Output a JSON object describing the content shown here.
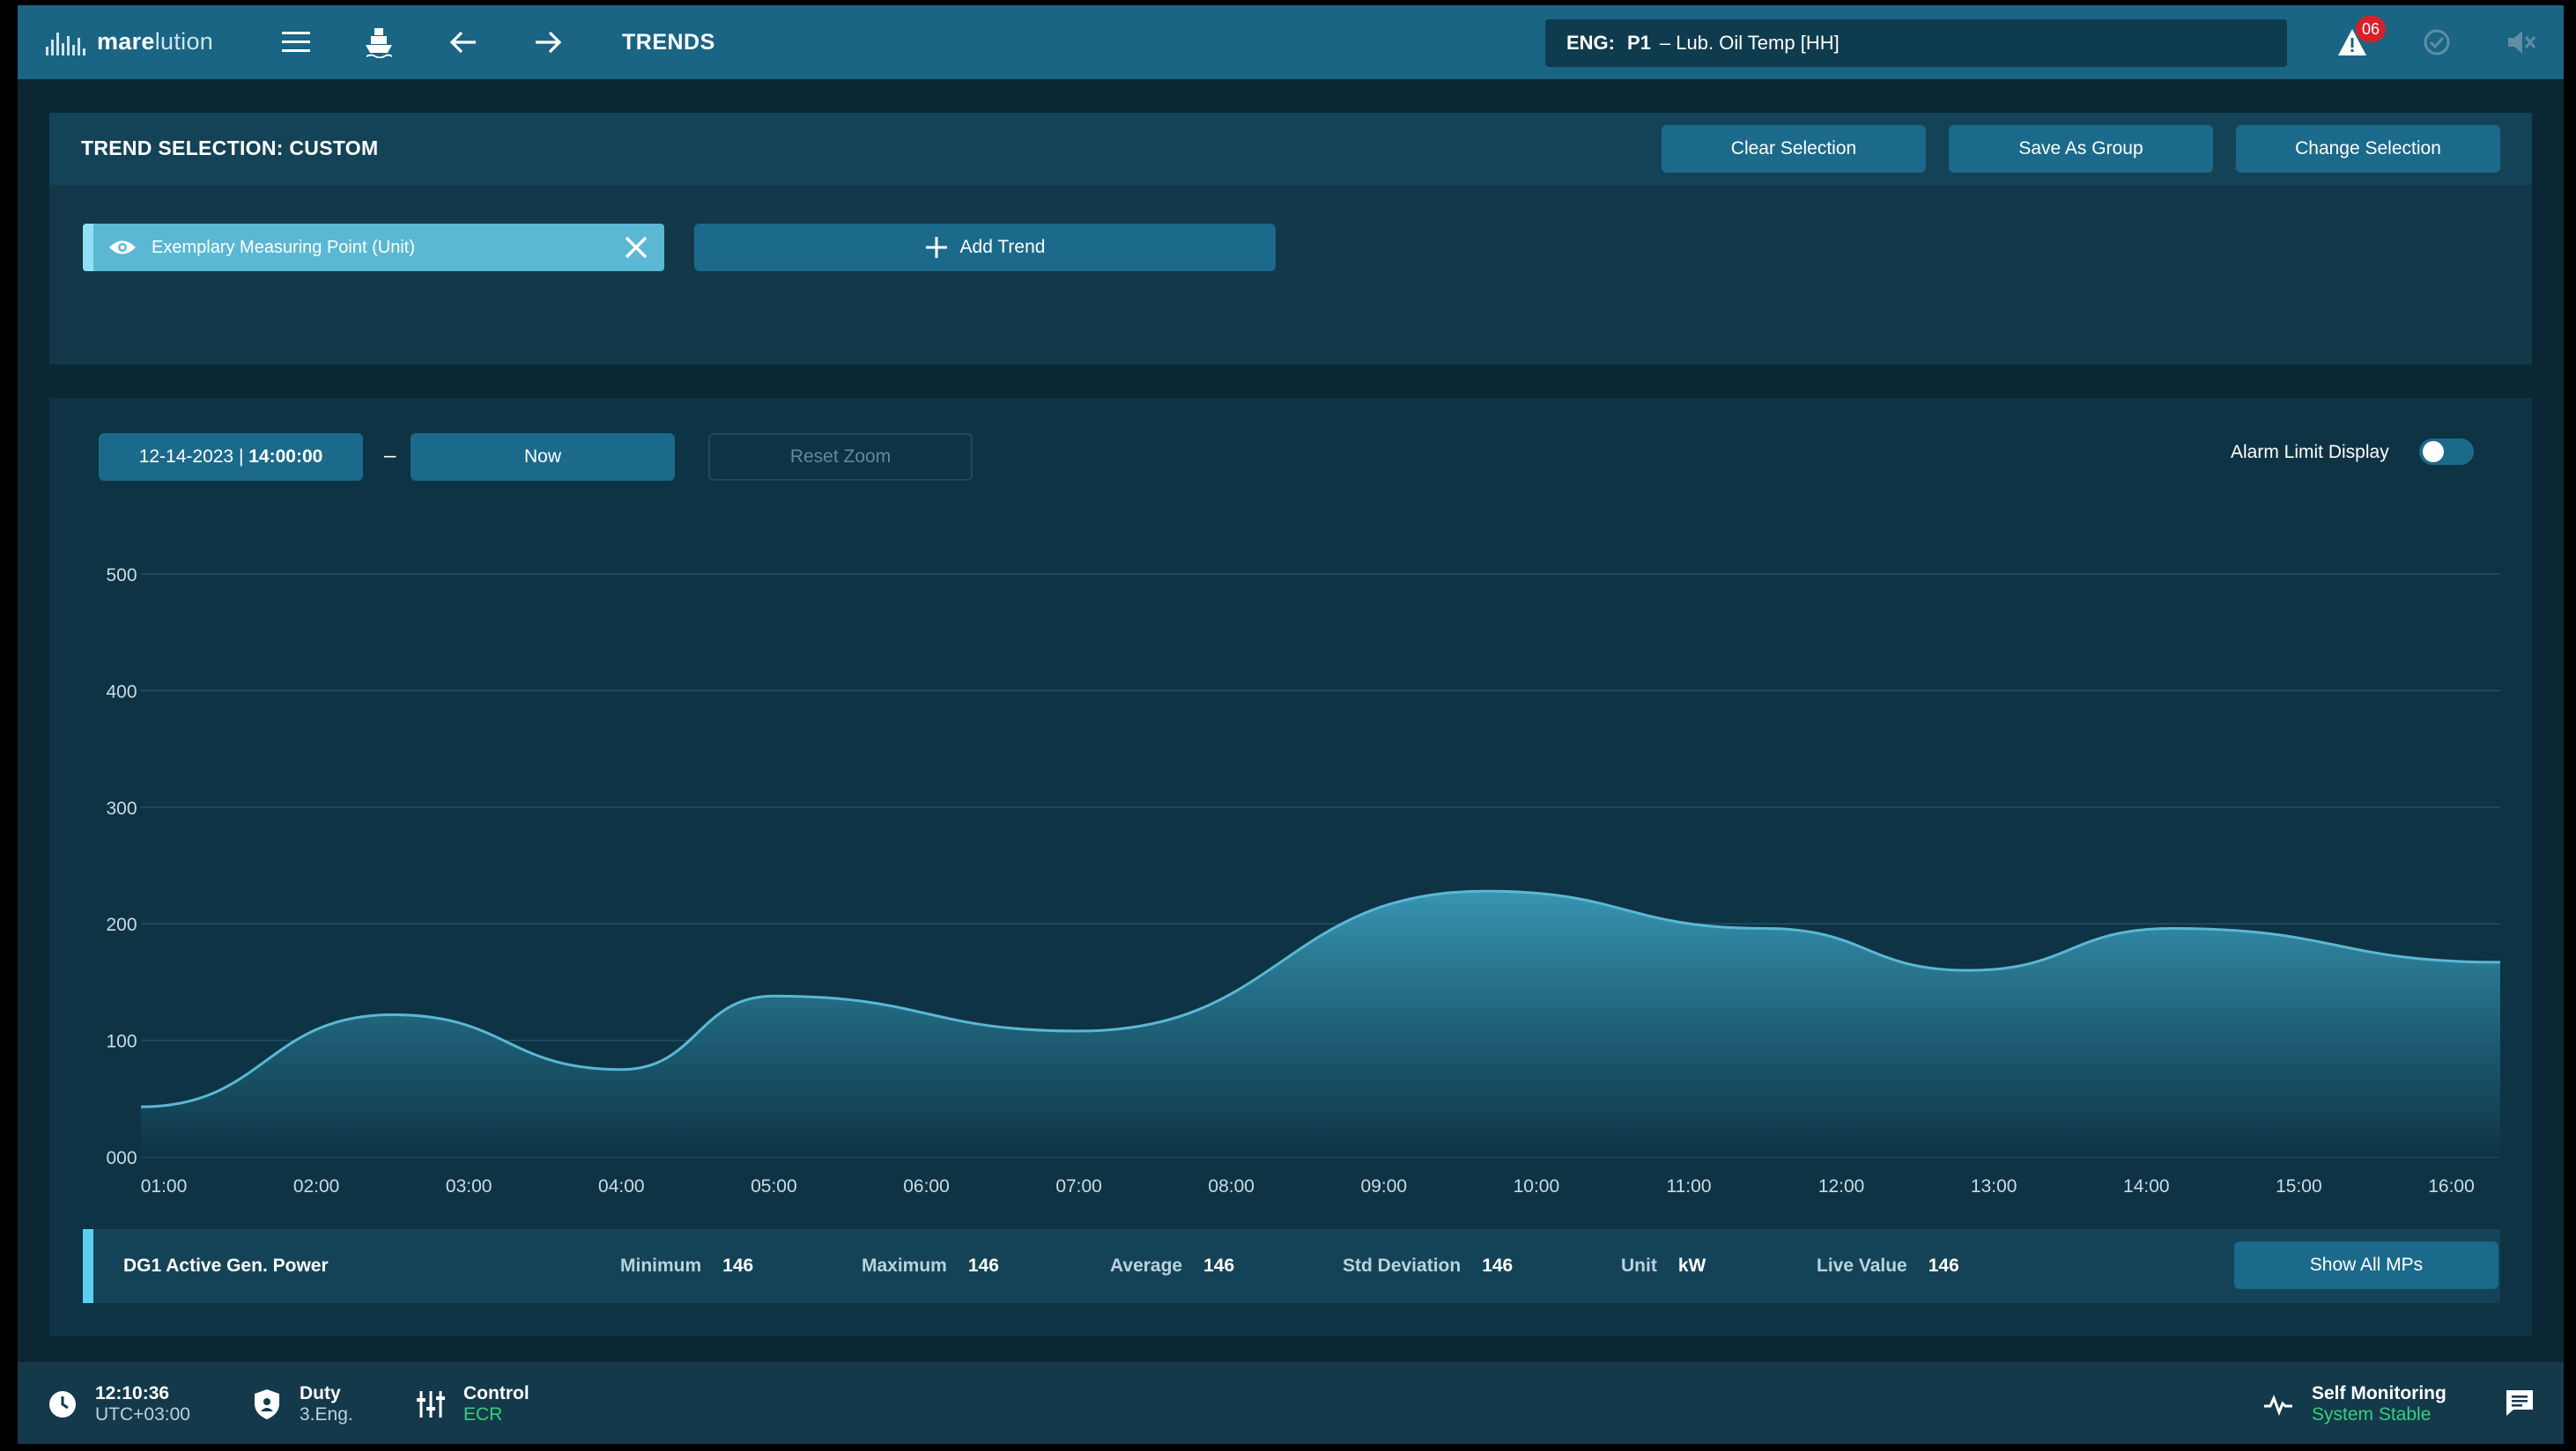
{
  "app": {
    "brand_bold": "mare",
    "brand_rest": "lution",
    "page_title": "TRENDS"
  },
  "alarm": {
    "key": "ENG:",
    "point": "P1",
    "text": "– Lub. Oil Temp [HH]",
    "count": "06"
  },
  "selection": {
    "title": "TREND SELECTION: CUSTOM",
    "clear_label": "Clear Selection",
    "save_label": "Save As Group",
    "change_label": "Change Selection",
    "chip_label": "Exemplary Measuring Point (Unit)",
    "add_label": "Add Trend"
  },
  "range": {
    "date": "12-14-2023 | ",
    "time": "14:00:00",
    "dash": "–",
    "to_label": "Now",
    "reset_label": "Reset Zoom",
    "alarm_limit_label": "Alarm Limit Display",
    "alarm_limit_on": false
  },
  "chart_data": {
    "type": "area",
    "x": [
      "01:00",
      "02:00",
      "03:00",
      "04:00",
      "05:00",
      "06:00",
      "07:00",
      "08:00",
      "09:00",
      "10:00",
      "11:00",
      "12:00",
      "13:00",
      "14:00",
      "15:00",
      "16:00"
    ],
    "points": [
      [
        "00:50",
        43
      ],
      [
        "02:30",
        122
      ],
      [
        "04:00",
        75
      ],
      [
        "05:00",
        138
      ],
      [
        "07:00",
        108
      ],
      [
        "09:40",
        228
      ],
      [
        "11:30",
        196
      ],
      [
        "12:50",
        160
      ],
      [
        "14:10",
        196
      ],
      [
        "16:20",
        167
      ]
    ],
    "yticks": [
      "000",
      "100",
      "200",
      "300",
      "400",
      "500"
    ],
    "ylim": [
      0,
      500
    ],
    "grid": true,
    "line_color": "#5ab8d4"
  },
  "stats": {
    "name": "DG1 Active Gen. Power",
    "min_label": "Minimum",
    "min": "146",
    "max_label": "Maximum",
    "max": "146",
    "avg_label": "Average",
    "avg": "146",
    "std_label": "Std Deviation",
    "std": "146",
    "unit_label": "Unit",
    "unit": "kW",
    "live_label": "Live Value",
    "live": "146",
    "show_all_label": "Show All MPs"
  },
  "footer": {
    "time": "12:10:36",
    "tz": "UTC+03:00",
    "duty_label": "Duty",
    "duty_value": "3.Eng.",
    "control_label": "Control",
    "control_value": "ECR",
    "monitor_label": "Self Monitoring",
    "monitor_value": "System Stable"
  }
}
